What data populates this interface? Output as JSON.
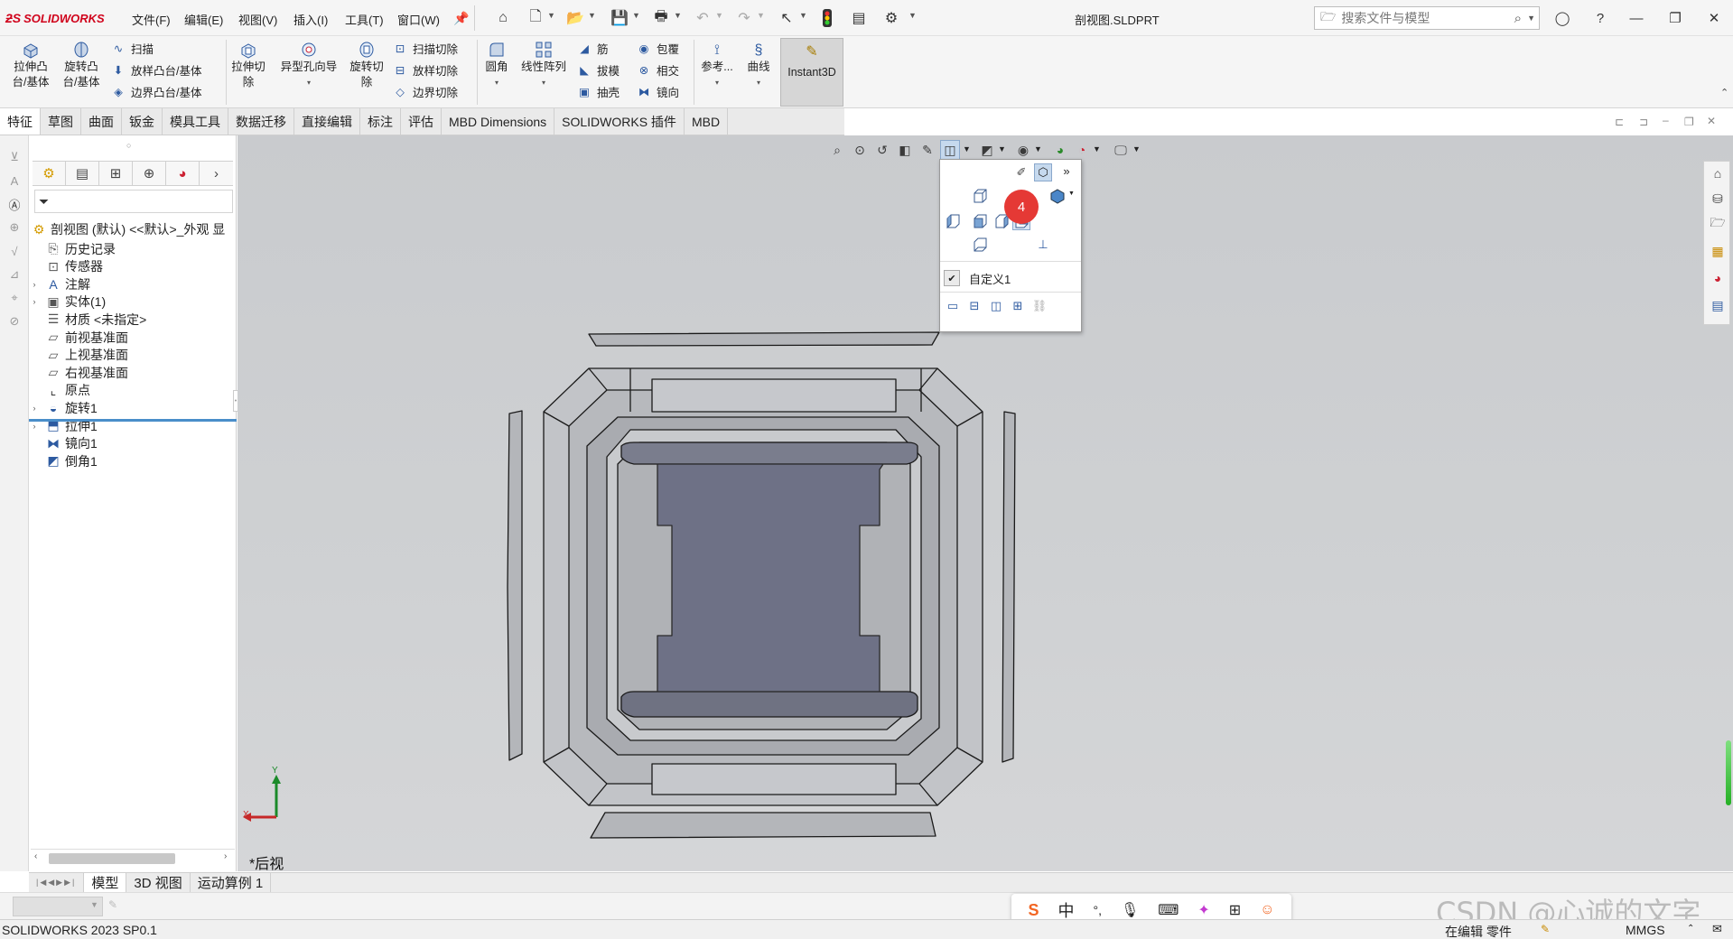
{
  "app": {
    "brand": "SOLIDWORKS",
    "document_title": "剖视图.SLDPRT",
    "menu": [
      "文件(F)",
      "编辑(E)",
      "视图(V)",
      "插入(I)",
      "工具(T)",
      "窗口(W)"
    ],
    "search_placeholder": "搜索文件与模型"
  },
  "ribbon": {
    "extrude_boss": "拉伸凸\n台/基体",
    "revolve_boss": "旋转凸\n台/基体",
    "sweep": "扫描",
    "loft_boss": "放样凸台/基体",
    "boundary_boss": "边界凸台/基体",
    "extrude_cut": "拉伸切\n除",
    "hole_wizard": "异型孔向导",
    "revolve_cut": "旋转切\n除",
    "swept_cut": "扫描切除",
    "lofted_cut": "放样切除",
    "boundary_cut": "边界切除",
    "fillet": "圆角",
    "linear_pattern": "线性阵列",
    "rib": "筋",
    "draft": "拔模",
    "shell": "抽壳",
    "wrap": "包覆",
    "intersect": "相交",
    "mirror": "镜向",
    "reference": "参考...",
    "curves": "曲线",
    "instant3d": "Instant3D"
  },
  "tabs": [
    "特征",
    "草图",
    "曲面",
    "钣金",
    "模具工具",
    "数据迁移",
    "直接编辑",
    "标注",
    "评估",
    "MBD Dimensions",
    "SOLIDWORKS 插件",
    "MBD"
  ],
  "active_tab": 0,
  "tree": {
    "root": "剖视图 (默认) <<默认>_外观 显",
    "items": [
      {
        "label": "历史记录",
        "icon": "history-icon",
        "caret": ""
      },
      {
        "label": "传感器",
        "icon": "sensor-icon",
        "caret": ""
      },
      {
        "label": "注解",
        "icon": "annotation-icon",
        "caret": "›"
      },
      {
        "label": "实体(1)",
        "icon": "solid-body-icon",
        "caret": "›"
      },
      {
        "label": "材质 <未指定>",
        "icon": "material-icon",
        "caret": ""
      },
      {
        "label": "前视基准面",
        "icon": "plane-icon",
        "caret": ""
      },
      {
        "label": "上视基准面",
        "icon": "plane-icon",
        "caret": ""
      },
      {
        "label": "右视基准面",
        "icon": "plane-icon",
        "caret": ""
      },
      {
        "label": "原点",
        "icon": "origin-icon",
        "caret": ""
      },
      {
        "label": "旋转1",
        "icon": "revolve-feature-icon",
        "caret": "›"
      },
      {
        "label": "拉伸1",
        "icon": "extrude-feature-icon",
        "caret": "›"
      },
      {
        "label": "镜向1",
        "icon": "mirror-feature-icon",
        "caret": ""
      },
      {
        "label": "倒角1",
        "icon": "chamfer-feature-icon",
        "caret": ""
      }
    ]
  },
  "viewport": {
    "view_name": "*后视",
    "axis_y": "Y",
    "axis_x": "X"
  },
  "popup": {
    "badge": "4",
    "custom_view": "自定义1",
    "custom_checked": true
  },
  "bottom_tabs": [
    "模型",
    "3D 视图",
    "运动算例 1"
  ],
  "active_bottom_tab": 0,
  "status": {
    "version": "SOLIDWORKS 2023 SP0.1",
    "mode": "在编辑 零件",
    "units": "MMGS"
  },
  "ime": {
    "lang": "中",
    "punct": "°,"
  },
  "watermark": "CSDN @心诚的文字",
  "colors": {
    "accent_red": "#d0021b",
    "badge_red": "#e53935",
    "viewport_bg": "#cdcfd1",
    "model_fill": "#6e7186"
  }
}
